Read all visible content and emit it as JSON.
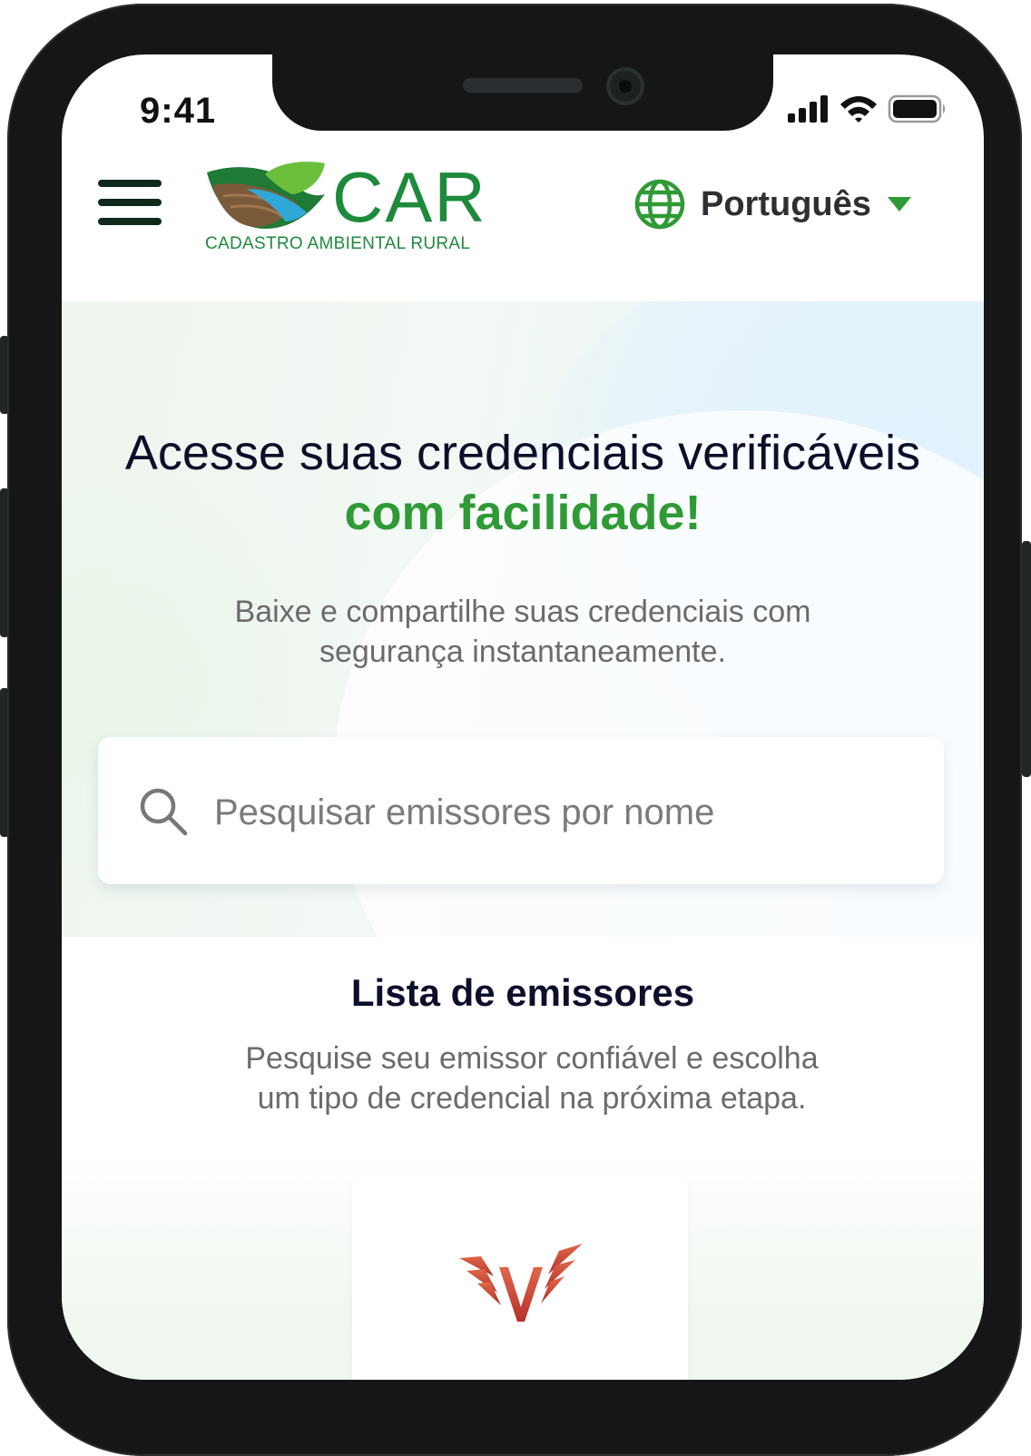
{
  "status_bar": {
    "time": "9:41"
  },
  "header": {
    "logo_text": "CAR",
    "logo_subtitle": "CADASTRO AMBIENTAL RURAL",
    "language": "Português"
  },
  "hero": {
    "title_main": "Acesse suas credenciais verificáveis",
    "title_accent": "com facilidade!",
    "subtitle_line1": "Baixe e compartilhe suas credenciais com",
    "subtitle_line2": "segurança instantaneamente."
  },
  "search": {
    "placeholder": "Pesquisar emissores por nome"
  },
  "issuers": {
    "title": "Lista de emissores",
    "subtitle_line1": "Pesquise seu emissor confiável e escolha",
    "subtitle_line2": "um tipo de credencial na próxima etapa."
  },
  "colors": {
    "brand_green": "#1e8a3c",
    "accent_green": "#2f9a36",
    "heading": "#0d0f2a",
    "body_text": "#6b6b6b"
  }
}
